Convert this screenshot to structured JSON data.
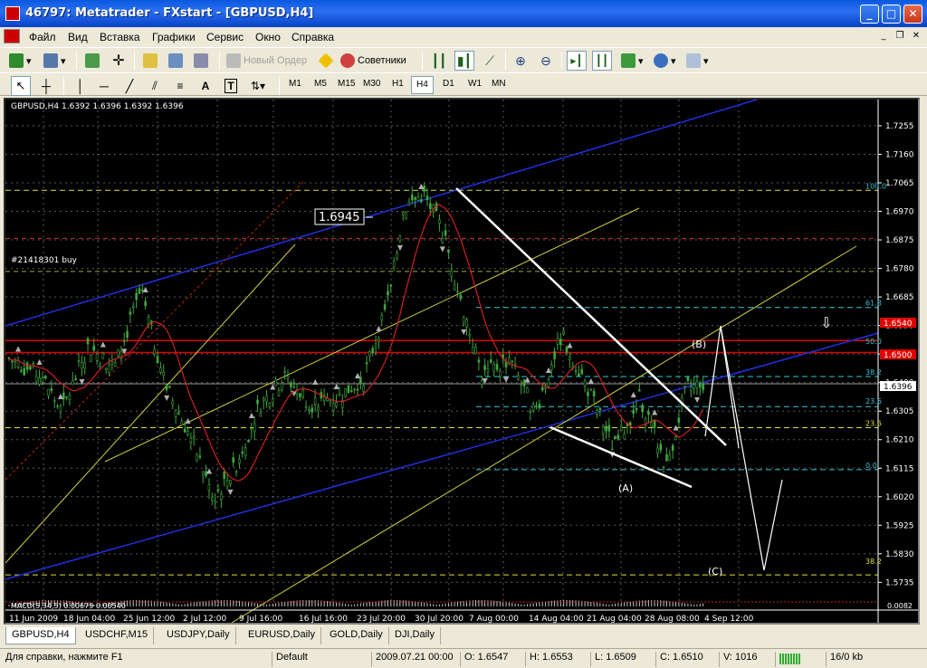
{
  "window": {
    "title": "46797: Metatrader - FXstart - [GBPUSD,H4]"
  },
  "menu": [
    "Файл",
    "Вид",
    "Вставка",
    "Графики",
    "Сервис",
    "Окно",
    "Справка"
  ],
  "toolbar": {
    "new_order": "Новый Ордер",
    "experts": "Советники"
  },
  "timeframes": [
    "M1",
    "M5",
    "M15",
    "M30",
    "H1",
    "H4",
    "D1",
    "W1",
    "MN"
  ],
  "active_timeframe": "H4",
  "chart": {
    "header": "GBPUSD,H4  1.6392 1.6396 1.6392 1.6396",
    "trade_label": "#21418301 buy",
    "big_price_label": "1.6945",
    "current_price": "1.6396",
    "macd_label": "MACD(5,34,5) 0.00679 0.00540",
    "macd_right": "0.0082",
    "wave_labels": [
      "(A)",
      "(B)",
      "(C)"
    ],
    "fib_labels": [
      "100.0",
      "61.8",
      "50.0",
      "38.2",
      "23.6",
      "23.6",
      "0.0",
      "38.2"
    ],
    "red_level_labels": [
      "1.6540",
      "1.6500"
    ]
  },
  "chart_data": {
    "type": "candlestick",
    "symbol": "GBPUSD",
    "timeframe": "H4",
    "price_axis": [
      "1.7255",
      "1.7160",
      "1.7065",
      "1.6970",
      "1.6875",
      "1.6780",
      "1.6685",
      "1.6590",
      "1.6495",
      "1.6400",
      "1.6305",
      "1.6210",
      "1.6115",
      "1.6020",
      "1.5925",
      "1.5830",
      "1.5735"
    ],
    "time_axis": [
      "11 Jun 2009",
      "18 Jun 04:00",
      "25 Jun 12:00",
      "2 Jul 12:00",
      "9 Jul 16:00",
      "16 Jul 16:00",
      "23 Jul 20:00",
      "30 Jul 20:00",
      "7 Aug 00:00",
      "14 Aug 04:00",
      "21 Aug 04:00",
      "28 Aug 08:00",
      "4 Sep 12:00"
    ],
    "ylim": [
      1.57,
      1.732
    ],
    "bid": 1.6396,
    "approx_path": [
      [
        0,
        1.648
      ],
      [
        5,
        1.642
      ],
      [
        8,
        1.63
      ],
      [
        12,
        1.652
      ],
      [
        16,
        1.645
      ],
      [
        20,
        1.67
      ],
      [
        24,
        1.638
      ],
      [
        28,
        1.62
      ],
      [
        31,
        1.602
      ],
      [
        34,
        1.61
      ],
      [
        38,
        1.632
      ],
      [
        42,
        1.642
      ],
      [
        46,
        1.633
      ],
      [
        50,
        1.635
      ],
      [
        54,
        1.642
      ],
      [
        58,
        1.67
      ],
      [
        60,
        1.698
      ],
      [
        63,
        1.703
      ],
      [
        66,
        1.69
      ],
      [
        69,
        1.665
      ],
      [
        72,
        1.642
      ],
      [
        76,
        1.648
      ],
      [
        80,
        1.63
      ],
      [
        84,
        1.656
      ],
      [
        88,
        1.638
      ],
      [
        92,
        1.618
      ],
      [
        96,
        1.635
      ],
      [
        100,
        1.612
      ],
      [
        103,
        1.638
      ],
      [
        106,
        1.6396
      ]
    ],
    "fib_levels": {
      "100.0": 1.704,
      "61.8": 1.665,
      "50.0": 1.654,
      "38.2": 1.642,
      "23.6": 1.632,
      "0.0": 1.611
    },
    "red_levels": [
      1.688,
      1.6545,
      1.65,
      1.677
    ],
    "yellow_levels": [
      1.704,
      1.625,
      1.576
    ]
  },
  "tabs": [
    "GBPUSD,H4",
    "USDCHF,M15",
    "USDJPY,Daily",
    "EURUSD,Daily",
    "GOLD,Daily",
    "DJI,Daily"
  ],
  "status": {
    "help": "Для справки, нажмите F1",
    "profile": "Default",
    "time": "2009.07.21 00:00",
    "open": "O: 1.6547",
    "high": "H: 1.6553",
    "low": "L: 1.6509",
    "close": "C: 1.6510",
    "volume": "V: 1016",
    "traffic": "16/0 kb"
  }
}
